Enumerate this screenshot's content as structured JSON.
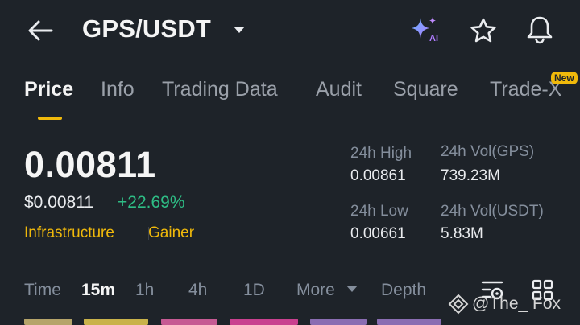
{
  "header": {
    "pair": "GPS/USDT",
    "ai_label": "AI"
  },
  "tabs": [
    {
      "label": "Price",
      "active": true
    },
    {
      "label": "Info"
    },
    {
      "label": "Trading Data"
    },
    {
      "label": "Audit"
    },
    {
      "label": "Square"
    },
    {
      "label": "Trade-X",
      "badge": "New"
    }
  ],
  "price": {
    "last": "0.00811",
    "usd": "$0.00811",
    "change": "+22.69%",
    "tags": [
      "Infrastructure",
      "Gainer"
    ]
  },
  "stats": {
    "high_label": "24h High",
    "high_value": "0.00861",
    "low_label": "24h Low",
    "low_value": "0.00661",
    "vol_base_label": "24h Vol(GPS)",
    "vol_base_value": "739.23M",
    "vol_quote_label": "24h Vol(USDT)",
    "vol_quote_value": "5.83M"
  },
  "timeframes": {
    "label": "Time",
    "items": [
      "15m",
      "1h",
      "4h",
      "1D"
    ],
    "active": "15m",
    "more": "More",
    "depth": "Depth"
  },
  "watermark": "@The_ Fox",
  "colors": {
    "background": "#1e2329",
    "accent": "#f0b90b",
    "up": "#2ebd85",
    "muted": "#848e9c"
  },
  "icons": [
    "back-arrow-icon",
    "caret-down-icon",
    "ai-sparkle-icon",
    "star-icon",
    "bell-icon",
    "indicator-icon",
    "grid-icon",
    "binance-diamond-icon"
  ]
}
